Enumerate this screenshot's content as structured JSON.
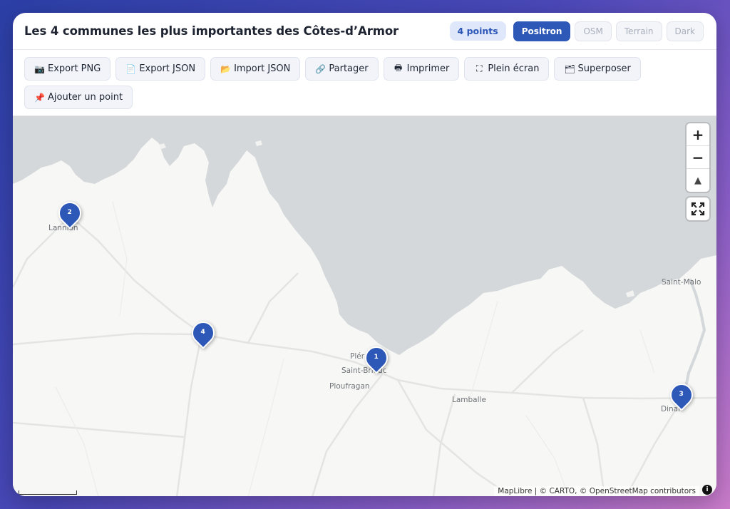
{
  "header": {
    "title": "Les 4 communes les plus importantes des Côtes-d’Armor",
    "count_badge": "4 points",
    "styles": [
      {
        "label": "Positron",
        "active": true
      },
      {
        "label": "OSM",
        "active": false
      },
      {
        "label": "Terrain",
        "active": false
      },
      {
        "label": "Dark",
        "active": false
      }
    ]
  },
  "toolbar": {
    "buttons": [
      {
        "label": "Export PNG",
        "icon": "camera-icon",
        "glyph": "📷"
      },
      {
        "label": "Export JSON",
        "icon": "file-icon",
        "glyph": "📄"
      },
      {
        "label": "Import JSON",
        "icon": "folder-open-icon",
        "glyph": "📂"
      },
      {
        "label": "Partager",
        "icon": "link-icon",
        "glyph": "🔗"
      },
      {
        "label": "Imprimer",
        "icon": "printer-icon",
        "glyph": "🖶"
      },
      {
        "label": "Plein écran",
        "icon": "fullscreen-icon",
        "glyph": "⛶"
      },
      {
        "label": "Superposer",
        "icon": "layers-icon",
        "glyph": "🗂"
      },
      {
        "label": "Ajouter un point",
        "icon": "pushpin-icon",
        "glyph": "📌"
      }
    ]
  },
  "map": {
    "labels": {
      "lannion": "Lannion",
      "saint_malo": "Saint-Malo",
      "plerin": "Plér",
      "saint_brieuc": "Saint-Brieuc",
      "ploufragan": "Ploufragan",
      "lamballe": "Lamballe",
      "dinan": "Dinan"
    },
    "markers": [
      {
        "name": "marker-lannion",
        "number": "2"
      },
      {
        "name": "marker-guingamp",
        "number": "4"
      },
      {
        "name": "marker-saint-brieuc",
        "number": "1"
      },
      {
        "name": "marker-dinan",
        "number": "3"
      }
    ],
    "controls": {
      "zoom_in": "+",
      "zoom_out": "−",
      "compass": "▲"
    },
    "attribution": "MapLibre | © CARTO, © OpenStreetMap contributors",
    "colors": {
      "accent": "#2d58b7",
      "sea": "#d4d8da",
      "land": "#f7f7f6"
    }
  }
}
